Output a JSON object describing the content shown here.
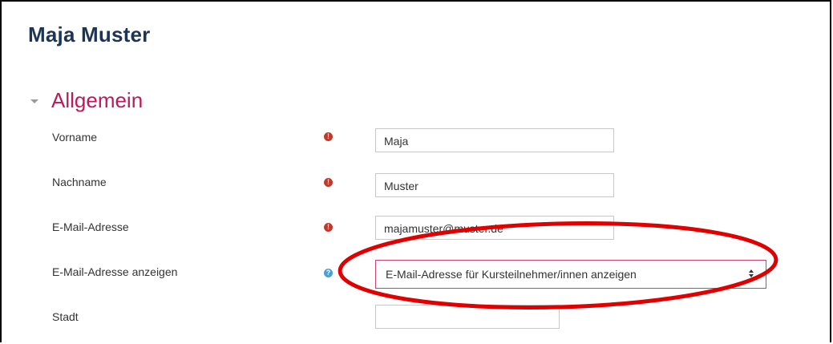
{
  "page_title": "Maja Muster",
  "section": {
    "title": "Allgemein"
  },
  "fields": [
    {
      "label": "Vorname",
      "value": "Maja",
      "indicator": "required"
    },
    {
      "label": "Nachname",
      "value": "Muster",
      "indicator": "required"
    },
    {
      "label": "E-Mail-Adresse",
      "value": "majamuster@muster.de",
      "indicator": "required"
    },
    {
      "label": "E-Mail-Adresse anzeigen",
      "value": "E-Mail-Adresse für Kursteilnehmer/innen anzeigen",
      "indicator": "help"
    },
    {
      "label": "Stadt",
      "value": ""
    }
  ],
  "icons": {
    "required": "exclamation-circle-icon",
    "help": "question-circle-icon",
    "section_toggle": "chevron-down-icon",
    "select_arrows": "up-down-arrows-icon"
  },
  "colors": {
    "title": "#1d3554",
    "section_title": "#c1185a",
    "required_icon": "#c0392b",
    "help_icon": "#4aa0d0",
    "annotation_ellipse": "#e00000"
  }
}
